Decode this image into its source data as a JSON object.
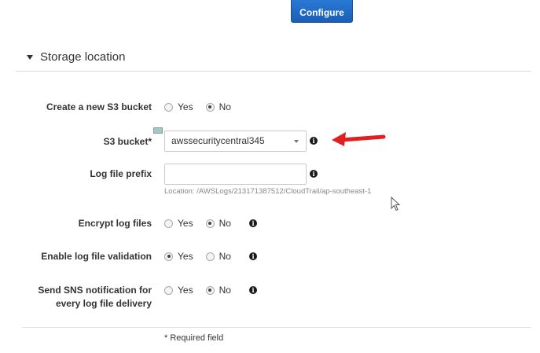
{
  "toolbar": {
    "configure_label": "Configure"
  },
  "section": {
    "title": "Storage location"
  },
  "form": {
    "create_bucket": {
      "label": "Create a new S3 bucket",
      "options": [
        "Yes",
        "No"
      ],
      "selected": "No"
    },
    "s3_bucket": {
      "label": "S3 bucket*",
      "value": "awssecuritycentral345"
    },
    "log_prefix": {
      "label": "Log file prefix",
      "value": "",
      "location_hint": "Location: /AWSLogs/213171387512/CloudTrail/ap-southeast-1"
    },
    "encrypt": {
      "label": "Encrypt log files",
      "options": [
        "Yes",
        "No"
      ],
      "selected": "No"
    },
    "validation": {
      "label": "Enable log file validation",
      "options": [
        "Yes",
        "No"
      ],
      "selected": "Yes"
    },
    "sns": {
      "label_line1": "Send SNS notification for",
      "label_line2": "every log file delivery",
      "options": [
        "Yes",
        "No"
      ],
      "selected": "No"
    },
    "required_note": "* Required field"
  },
  "icons": {
    "info": "info-icon",
    "caret": "caret-down-icon",
    "arrow": "red-arrow-annotation",
    "cursor": "mouse-pointer-icon"
  },
  "colors": {
    "primary_button": "#1a5fb8",
    "annotation_arrow": "#e02020",
    "divider": "#d9d9d9"
  }
}
